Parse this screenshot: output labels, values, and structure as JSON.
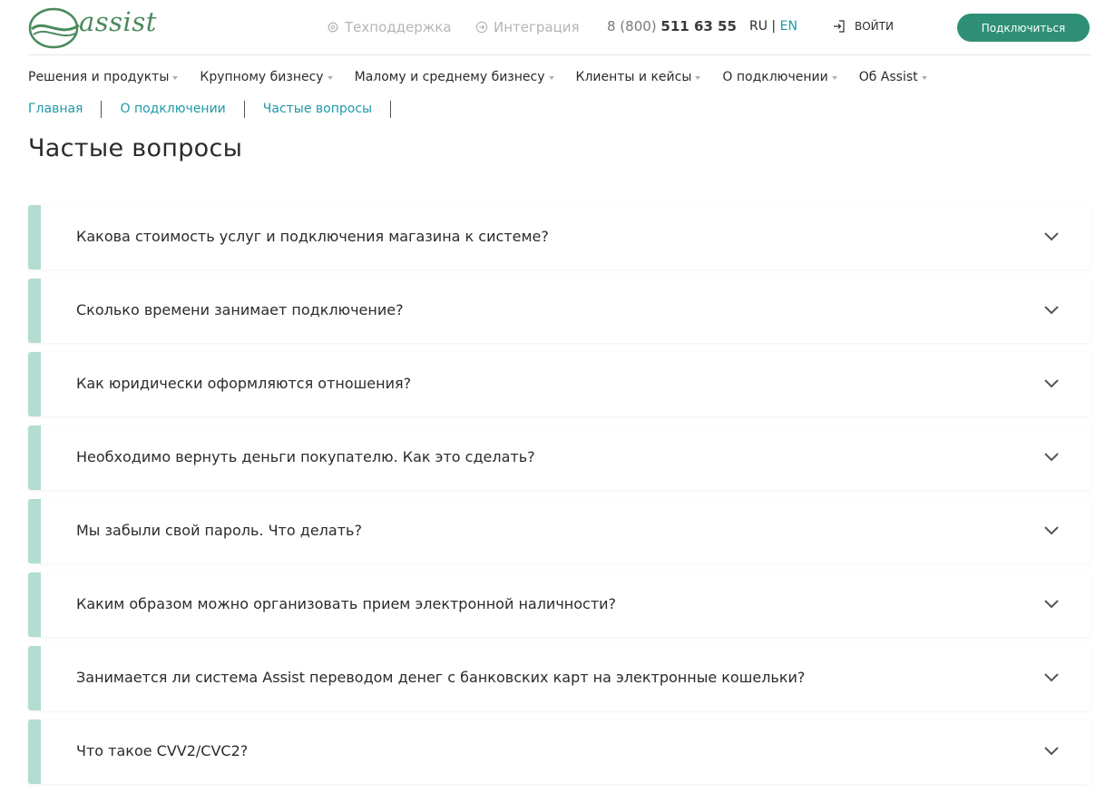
{
  "header": {
    "logo_text": "assist",
    "support_label": "Техподдержка",
    "integration_label": "Интеграция",
    "phone_prefix": "8 (800) ",
    "phone_number": "511 63 55",
    "lang_ru": "RU",
    "lang_sep": " | ",
    "lang_en": "EN",
    "login_label": "ВОЙТИ",
    "connect_label": "Подключиться",
    "colors": {
      "accent": "#2f8f76",
      "link": "#1f9aa8",
      "logo": "#4a8a5d"
    }
  },
  "nav": {
    "items": [
      "Решения и продукты",
      "Крупному бизнесу",
      "Малому и среднему бизнесу",
      "Клиенты и кейсы",
      "О подключении",
      "Об Assist"
    ]
  },
  "breadcrumb": [
    "Главная",
    "О подключении",
    "Частые вопросы"
  ],
  "page_title": "Частые вопросы",
  "faq": [
    "Какова стоимость услуг и подключения магазина к системе?",
    "Сколько времени занимает подключение?",
    "Как юридически оформляются отношения?",
    "Необходимо вернуть деньги покупателю. Как это сделать?",
    "Мы забыли свой пароль. Что делать?",
    "Каким образом можно организовать прием электронной наличности?",
    "Занимается ли система Assist переводом денег с банковских карт на электронные кошельки?",
    "Что такое CVV2/CVC2?"
  ],
  "icons": {
    "logo": "assist-logo-icon",
    "support": "gear-icon",
    "integration": "arrow-circle-icon",
    "login": "login-icon",
    "expand": "chevron-down-icon"
  }
}
